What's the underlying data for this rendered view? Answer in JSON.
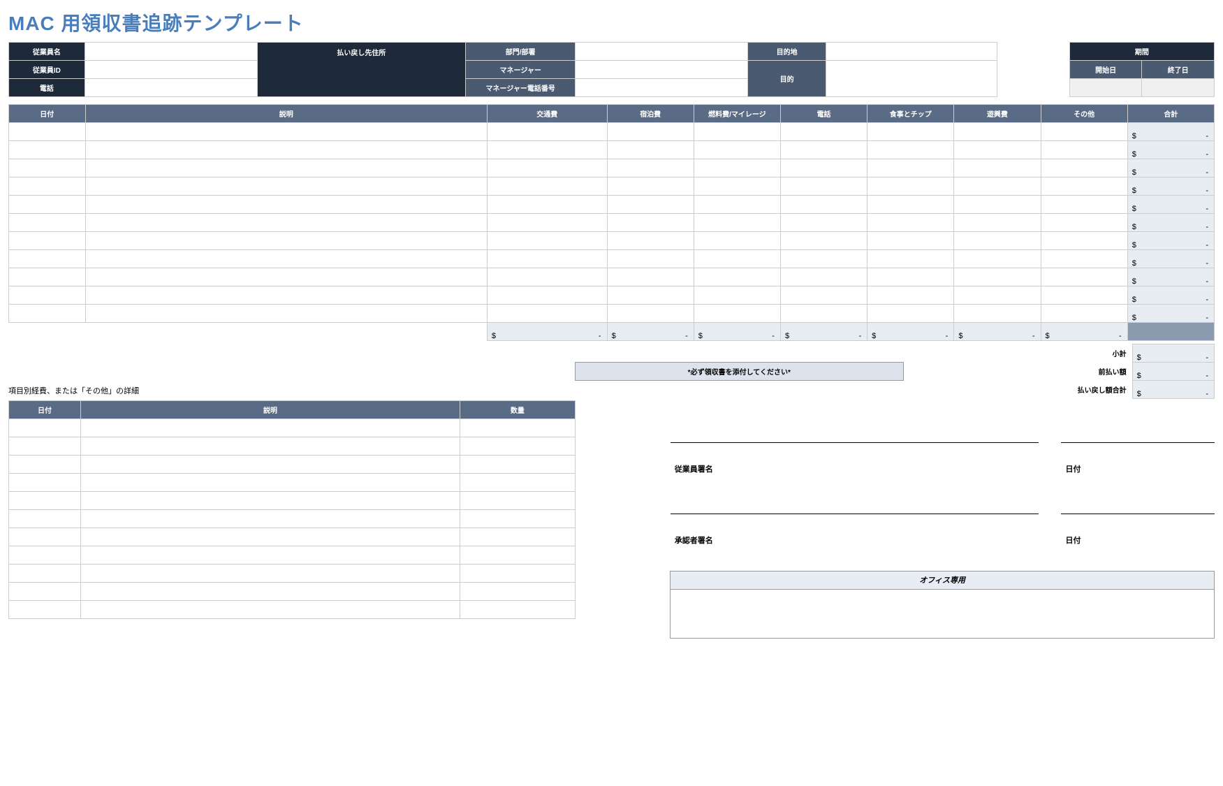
{
  "title": "MAC 用領収書追跡テンプレート",
  "header": {
    "employee_name": "従業員名",
    "employee_id": "従業員ID",
    "phone": "電話",
    "refund_address": "払い戻し先住所",
    "dept": "部門/部署",
    "manager": "マネージャー",
    "manager_phone": "マネージャー電話番号",
    "destination": "目的地",
    "purpose": "目的",
    "period": "期間",
    "start_date": "開始日",
    "end_date": "終了日"
  },
  "expense_columns": {
    "date": "日付",
    "description": "説明",
    "transport": "交通費",
    "lodging": "宿泊費",
    "fuel": "燃料費/マイレージ",
    "phone": "電話",
    "meals": "食事とチップ",
    "entertainment": "遊興費",
    "other": "その他",
    "total": "合計"
  },
  "currency": "$",
  "dash": "-",
  "summary": {
    "subtotal": "小計",
    "advance": "前払い額",
    "reimbursement": "払い戻し額合計"
  },
  "attach_note": "*必ず領収書を添付してください*",
  "itemized_title": "項目別経費、または「その他」の詳細",
  "itemized_columns": {
    "date": "日付",
    "description": "説明",
    "quantity": "数量"
  },
  "signatures": {
    "employee": "従業員署名",
    "approver": "承認者署名",
    "date": "日付"
  },
  "office_only": "オフィス専用",
  "expense_rows": 11,
  "itemized_rows": 11
}
